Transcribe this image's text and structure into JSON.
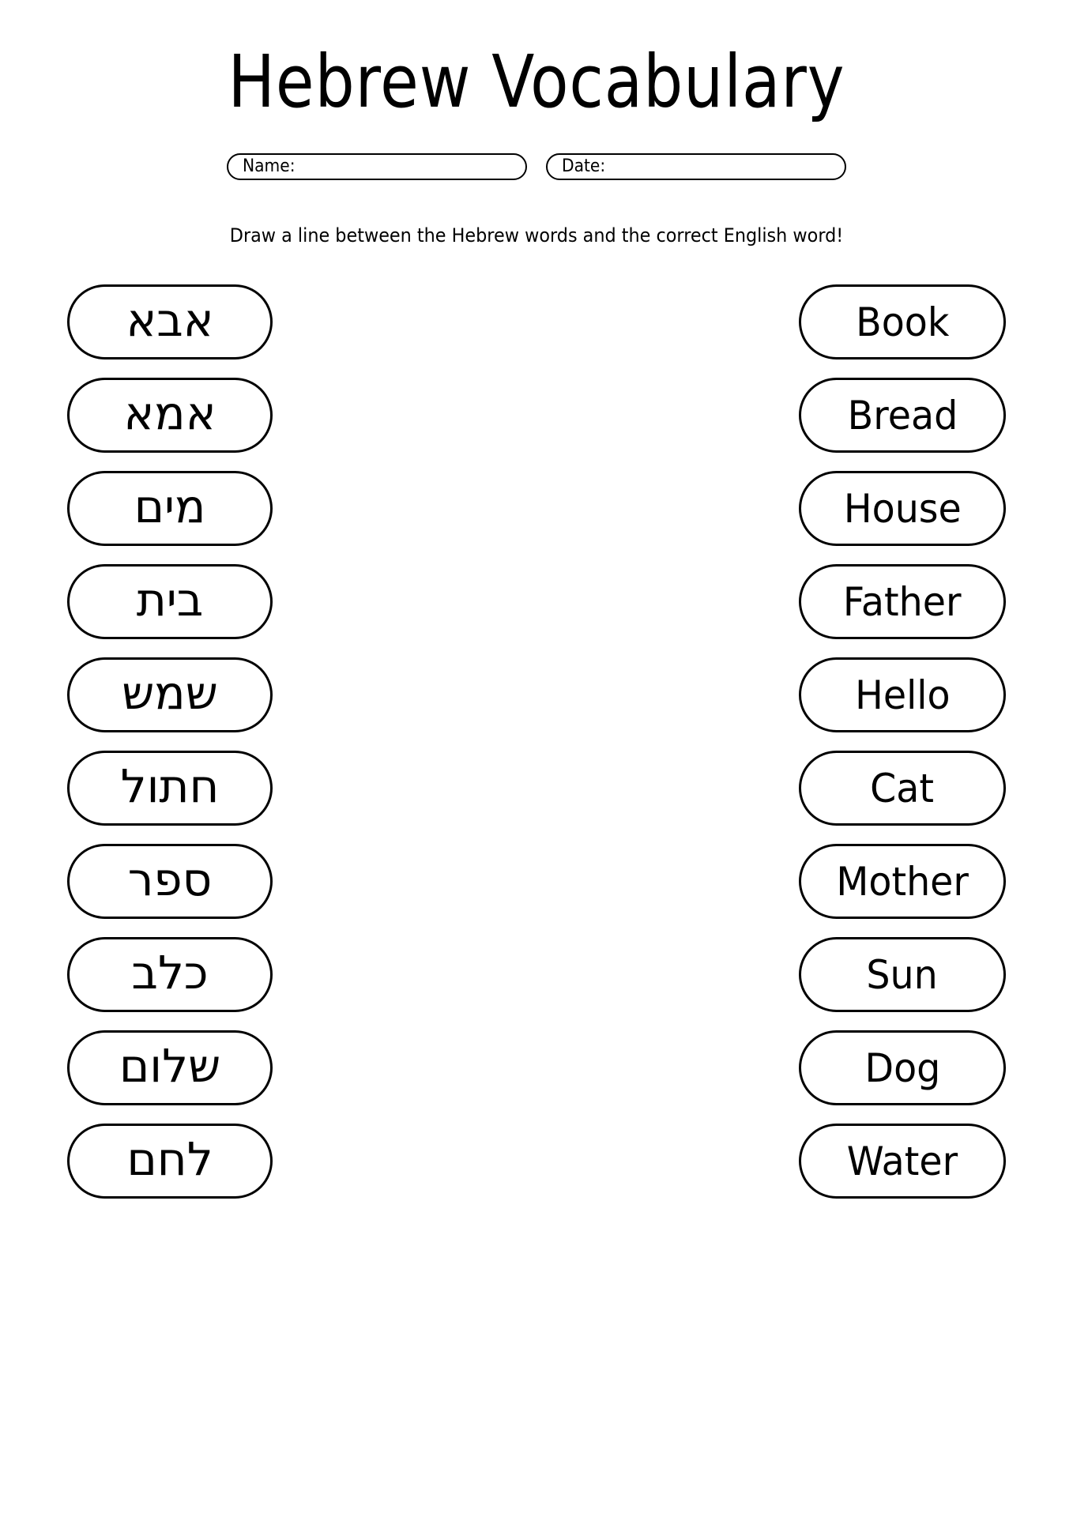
{
  "worksheet": {
    "title": "Hebrew Vocabulary",
    "instruction": "Draw a line between the Hebrew words and the correct English word!",
    "fields": {
      "name_label": "Name:",
      "name_value": "",
      "date_label": "Date:",
      "date_value": ""
    },
    "hebrew_column": [
      {
        "display": "אבא",
        "meaning": "Father"
      },
      {
        "display": "אמא",
        "meaning": "Mother"
      },
      {
        "display": "םימ",
        "meaning": "Water"
      },
      {
        "display": "תיב",
        "meaning": "House"
      },
      {
        "display": "שמש",
        "meaning": "Sun"
      },
      {
        "display": "לותח",
        "meaning": "Cat"
      },
      {
        "display": "רפס",
        "meaning": "Book"
      },
      {
        "display": "בלכ",
        "meaning": "Dog"
      },
      {
        "display": "םולש",
        "meaning": "Hello"
      },
      {
        "display": "םחל",
        "meaning": "Bread"
      }
    ],
    "english_column": [
      {
        "label": "Book"
      },
      {
        "label": "Bread"
      },
      {
        "label": "House"
      },
      {
        "label": "Father"
      },
      {
        "label": "Hello"
      },
      {
        "label": "Cat"
      },
      {
        "label": "Mother"
      },
      {
        "label": "Sun"
      },
      {
        "label": "Dog"
      },
      {
        "label": "Water"
      }
    ],
    "colors": {
      "ink": "#000000",
      "paper": "#ffffff"
    }
  }
}
